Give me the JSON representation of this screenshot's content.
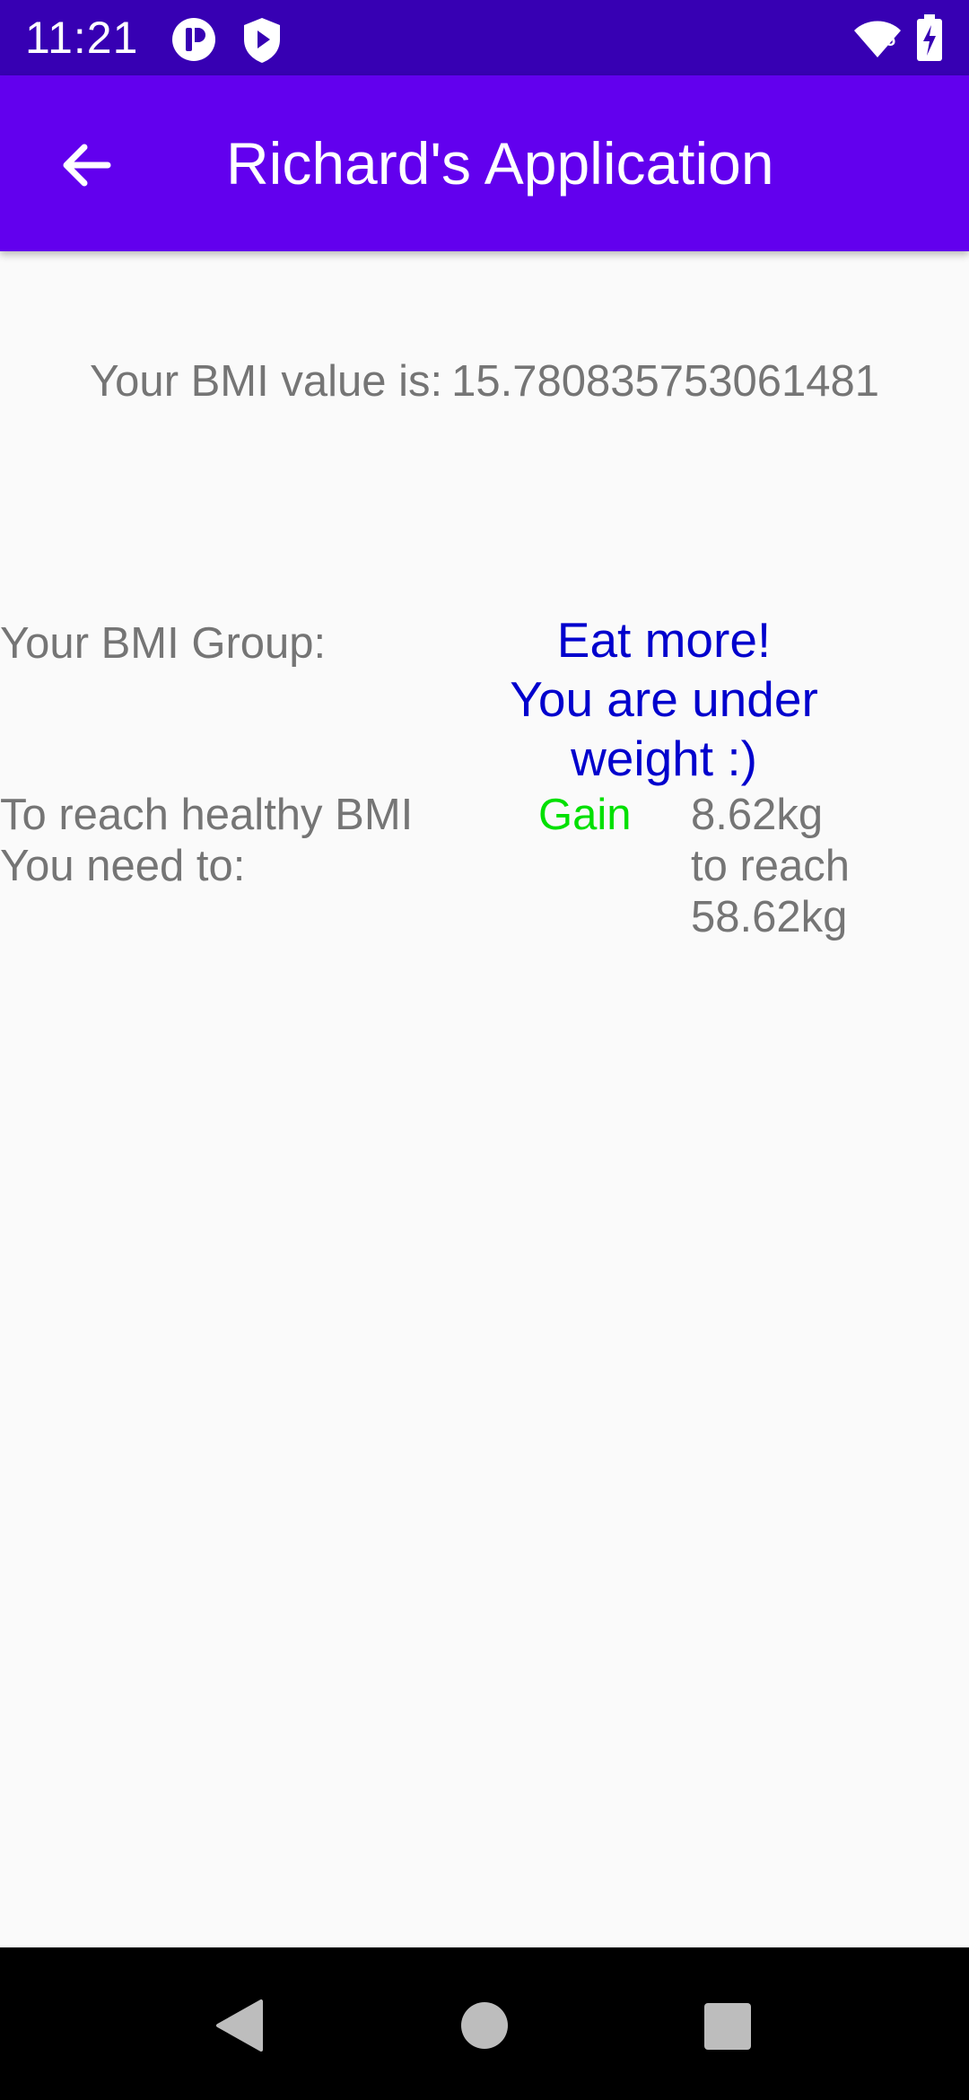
{
  "status_bar": {
    "time": "11:21",
    "icons": [
      "app-notification-icon",
      "play-protect-icon",
      "wifi-icon",
      "battery-charging-icon"
    ],
    "wifi_badge": "5"
  },
  "app_bar": {
    "title": "Richard's Application",
    "back_icon": "arrow-back-icon"
  },
  "bmi": {
    "value_label": "Your BMI value is:",
    "value": "15.780835753061481",
    "group_label": "Your BMI Group:",
    "group_message_lines": [
      "Eat more!",
      "You are under",
      "weight :)"
    ],
    "reach_label_lines": [
      "To reach healthy BMI",
      "You need to:"
    ],
    "action": "Gain",
    "target_lines": [
      "8.62kg",
      "to reach",
      "58.62kg"
    ]
  },
  "nav_bar": {
    "icons": [
      "back-triangle-icon",
      "home-circle-icon",
      "recents-square-icon"
    ]
  },
  "colors": {
    "status_bar": "#3700b3",
    "app_bar": "#6200ee",
    "background": "#fafafa",
    "gray_text": "#757575",
    "group_message": "#0000cd",
    "gain": "#00e000",
    "nav_bar": "#000000"
  }
}
